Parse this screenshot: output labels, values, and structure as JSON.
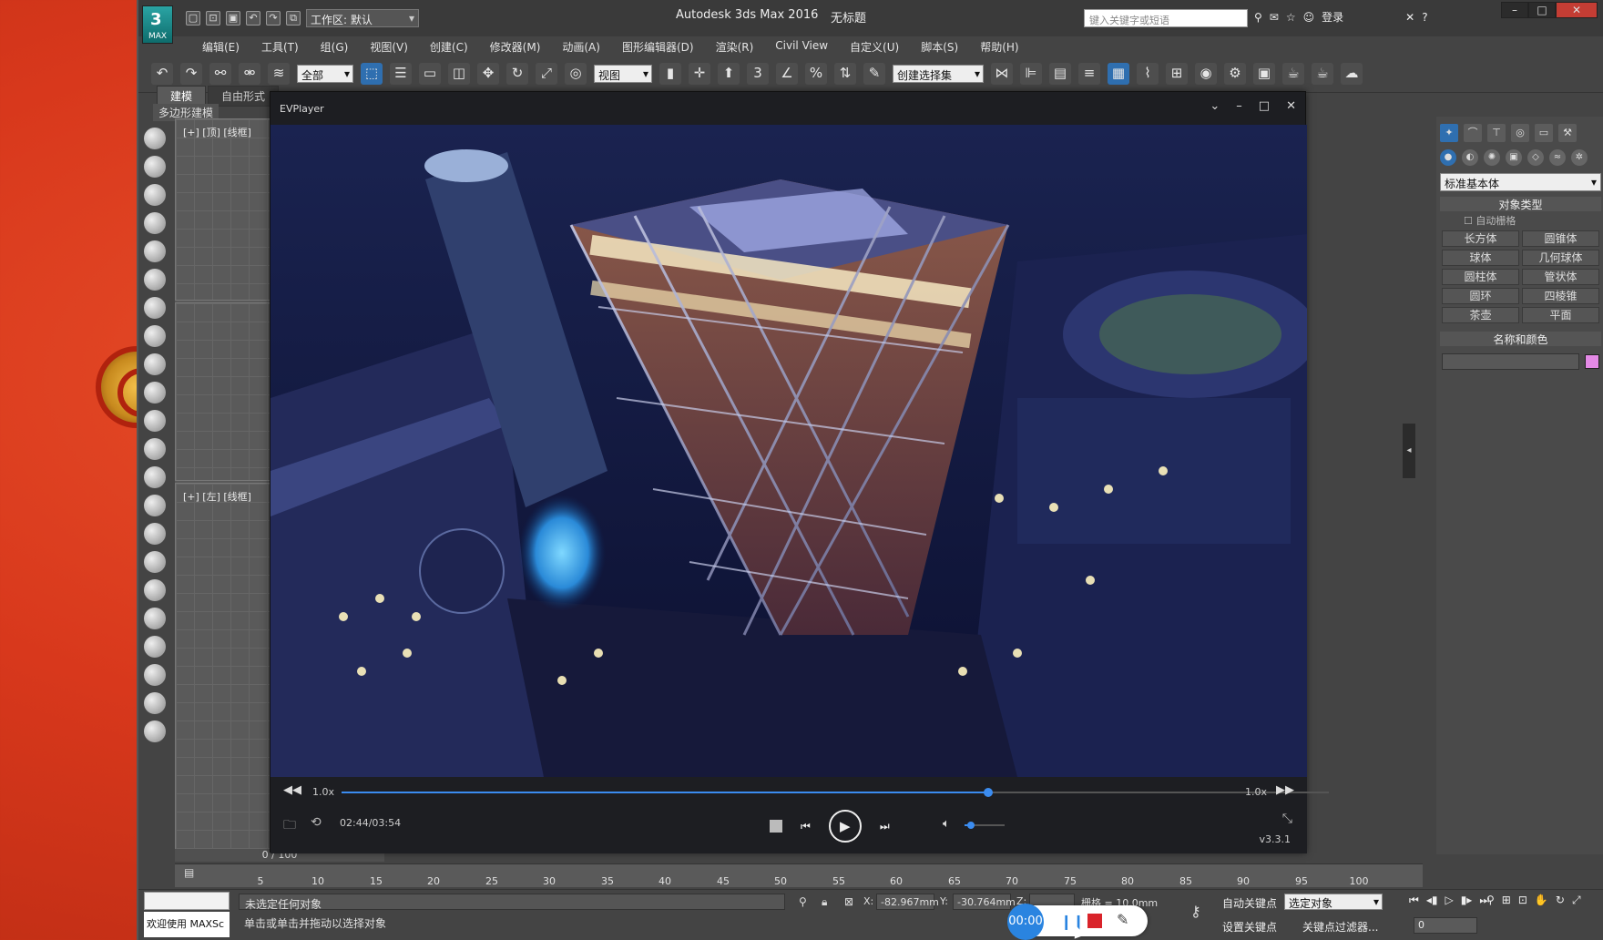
{
  "app": {
    "title": "Autodesk 3ds Max 2016",
    "doc_title": "无标题",
    "logo_label": "MAX",
    "workspace_label": "工作区: 默认",
    "search_placeholder": "键入关键字或短语",
    "login_label": "登录"
  },
  "menu": [
    "编辑(E)",
    "工具(T)",
    "组(G)",
    "视图(V)",
    "创建(C)",
    "修改器(M)",
    "动画(A)",
    "图形编辑器(D)",
    "渲染(R)",
    "Civil View",
    "自定义(U)",
    "脚本(S)",
    "帮助(H)"
  ],
  "toolbar": {
    "selection_filter": "全部",
    "ref_coord": "视图",
    "named_sel": "创建选择集"
  },
  "ribbon": {
    "tabs": [
      "建模",
      "自由形式"
    ],
    "sub_label": "多边形建模"
  },
  "viewports": [
    {
      "label": "[+] [顶] [线框]"
    },
    {
      "label": "[+] [左] [线框]"
    }
  ],
  "command_panel": {
    "primitive_type": "标准基本体",
    "object_type_header": "对象类型",
    "autogrid_label": "自动栅格",
    "buttons": [
      "长方体",
      "圆锥体",
      "球体",
      "几何球体",
      "圆柱体",
      "管状体",
      "圆环",
      "四棱锥",
      "茶壶",
      "平面"
    ],
    "name_color_header": "名称和颜色",
    "color": "#e48ae6"
  },
  "evplayer": {
    "title": "EVPlayer",
    "speed_left": "1.0x",
    "speed_right": "1.0x",
    "time": "02:44/03:54",
    "progress": 0.655,
    "volume": 0.15,
    "version": "v3.3.1"
  },
  "timeline": {
    "slider_label": "0 / 100",
    "ticks": [
      "5",
      "10",
      "15",
      "20",
      "25",
      "30",
      "35",
      "40",
      "45",
      "50",
      "55",
      "60",
      "65",
      "70",
      "75",
      "80",
      "85",
      "90",
      "95",
      "100"
    ]
  },
  "status": {
    "welcome": "欢迎使用 MAXSc",
    "message": "未选定任何对象",
    "hint": "单击或单击并拖动以选择对象",
    "x_label": "X:",
    "x_value": "-82.967mm",
    "y_label": "Y:",
    "y_value": "-30.764mm",
    "z_label": "Z:",
    "grid_label": "栅格 = 10.0mm",
    "autokey_label": "自动关键点",
    "setkey_label": "设置关键点",
    "selected_label": "选定对象",
    "keyfilter_label": "关键点过滤器...",
    "frame_value": "0"
  },
  "recorder": {
    "time": "00:00"
  }
}
